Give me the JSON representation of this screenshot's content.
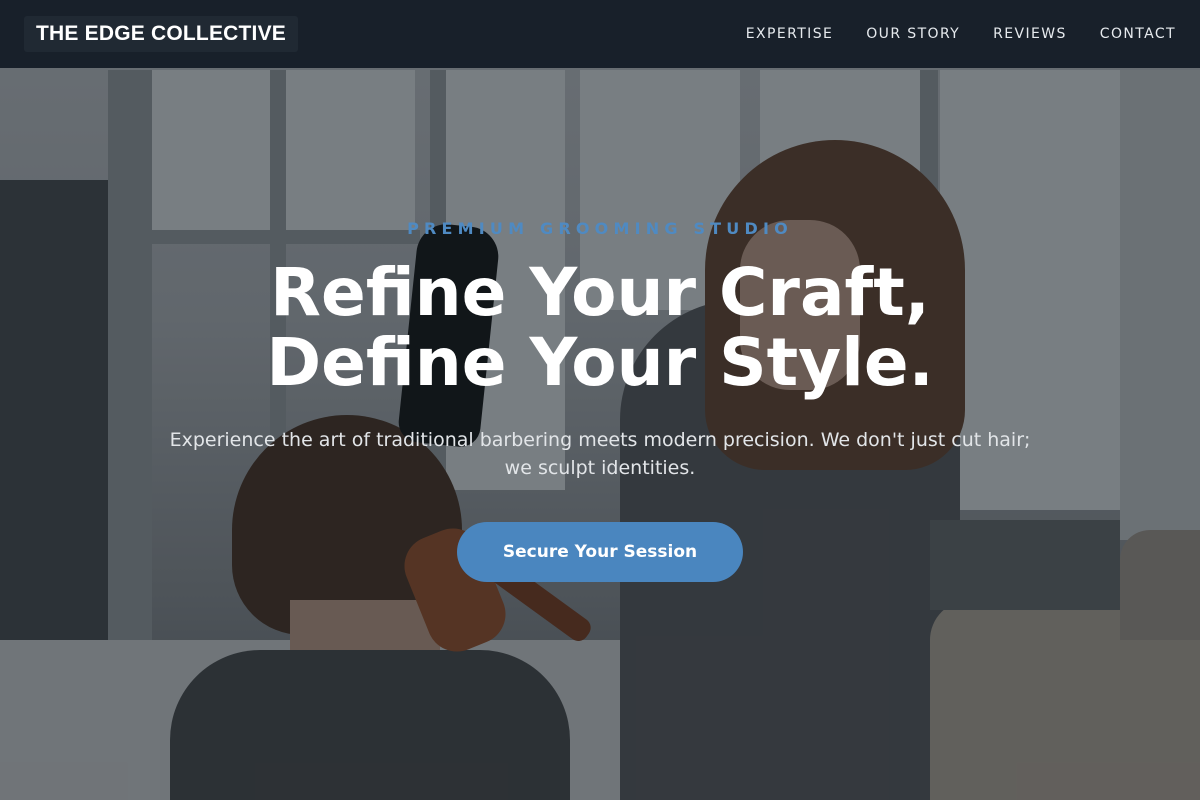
{
  "brand": {
    "name": "THE EDGE COLLECTIVE"
  },
  "nav": {
    "items": [
      {
        "label": "EXPERTISE"
      },
      {
        "label": "OUR STORY"
      },
      {
        "label": "REVIEWS"
      },
      {
        "label": "CONTACT"
      }
    ]
  },
  "hero": {
    "eyebrow": "PREMIUM GROOMING STUDIO",
    "headline_line1": "Refine Your Craft,",
    "headline_line2": "Define Your Style.",
    "subtext": "Experience the art of traditional barbering meets modern precision. We don't just cut hair; we sculpt identities.",
    "cta_label": "Secure Your Session",
    "background_image": "salon-hairdresser-photo"
  },
  "colors": {
    "nav_background": "#18202a",
    "accent": "#4a86bf",
    "eyebrow": "#4f8ac2",
    "text_primary": "#ffffff"
  }
}
